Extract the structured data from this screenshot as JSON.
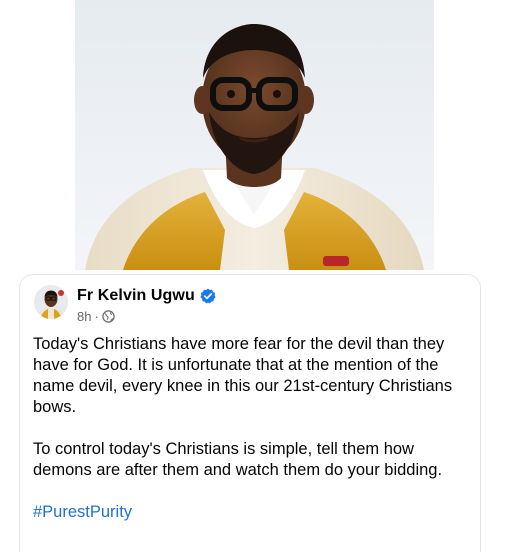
{
  "post": {
    "author_name": "Fr Kelvin Ugwu",
    "verified_icon": "verified-badge-icon",
    "time": "8h",
    "separator": "·",
    "audience_icon": "globe-icon",
    "paragraph_1": "Today's Christians have more fear for the devil than they have for God. It is unfortunate that at the mention of the name devil, every knee in this our 21st-century Christians bows.",
    "paragraph_2": "To control today's Christians is simple, tell them how demons are after them and watch them do your bidding.",
    "hashtag": "#PurestPurity"
  },
  "colors": {
    "text": "#050505",
    "meta": "#65676b",
    "link": "#216fdb",
    "verified": "#1877f2",
    "vestment_gold": "#d8a422",
    "vestment_cream": "#efe6d5"
  }
}
